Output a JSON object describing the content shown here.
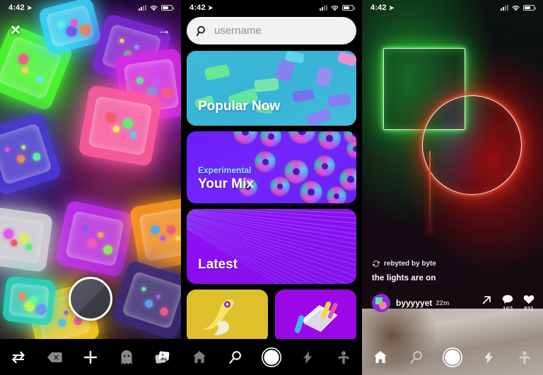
{
  "status_bar": {
    "time": "4:42",
    "location_icon": "location-arrow-icon",
    "wifi_icon": "wifi-icon",
    "battery_icon": "battery-icon"
  },
  "camera_panel": {
    "close_label": "✕",
    "next_label": "→",
    "shutter_name": "shutter-button",
    "nav": [
      {
        "name": "nav-flip-camera",
        "icon": "swap-arrows-icon",
        "active": false
      },
      {
        "name": "nav-erase",
        "icon": "backspace-icon",
        "active": false
      },
      {
        "name": "nav-add",
        "icon": "plus-icon",
        "active": true
      },
      {
        "name": "nav-ghost",
        "icon": "ghost-icon",
        "active": false
      },
      {
        "name": "nav-gallery",
        "icon": "photo-stack-icon",
        "active": false
      }
    ]
  },
  "explore_panel": {
    "search": {
      "placeholder": "username",
      "value": "",
      "icon": "search-icon"
    },
    "cards": [
      {
        "id": "popular",
        "label": "Popular Now",
        "sub": "",
        "accent": "#3fb8d8"
      },
      {
        "id": "mix",
        "label": "Your Mix",
        "sub": "Experimental",
        "accent": "#6a1ff5"
      },
      {
        "id": "latest",
        "label": "Latest",
        "sub": "",
        "accent": "#8f12f5"
      },
      {
        "id": "yellow",
        "label": "",
        "sub": "",
        "accent": "#ddc02b"
      },
      {
        "id": "purple",
        "label": "",
        "sub": "",
        "accent": "#9b09e8"
      }
    ],
    "nav": [
      {
        "name": "nav-home",
        "icon": "home-icon",
        "active": false
      },
      {
        "name": "nav-search",
        "icon": "search-icon",
        "active": true
      },
      {
        "name": "nav-capture",
        "icon": "record-circle-icon",
        "active": false
      },
      {
        "name": "nav-activity",
        "icon": "lightning-bolt-icon",
        "active": false
      },
      {
        "name": "nav-profile",
        "icon": "person-icon",
        "active": false
      }
    ]
  },
  "feed_panel": {
    "rebyte": {
      "icon": "rebyte-loop-icon",
      "text": "rebyted by byte"
    },
    "caption": "the lights are on",
    "user": {
      "name": "byyyyyet",
      "time": "22m",
      "avatar": "user-avatar"
    },
    "actions": [
      {
        "name": "share-button",
        "icon": "share-arrow-icon",
        "count": ""
      },
      {
        "name": "comment-button",
        "icon": "comment-bubble-icon",
        "count": "162"
      },
      {
        "name": "like-button",
        "icon": "heart-icon",
        "count": "831"
      }
    ],
    "nav": [
      {
        "name": "nav-home",
        "icon": "home-icon",
        "active": true
      },
      {
        "name": "nav-search",
        "icon": "search-icon",
        "active": false
      },
      {
        "name": "nav-capture",
        "icon": "record-circle-icon",
        "active": false
      },
      {
        "name": "nav-activity",
        "icon": "lightning-bolt-icon",
        "active": false
      },
      {
        "name": "nav-profile",
        "icon": "person-icon",
        "active": false
      }
    ]
  }
}
